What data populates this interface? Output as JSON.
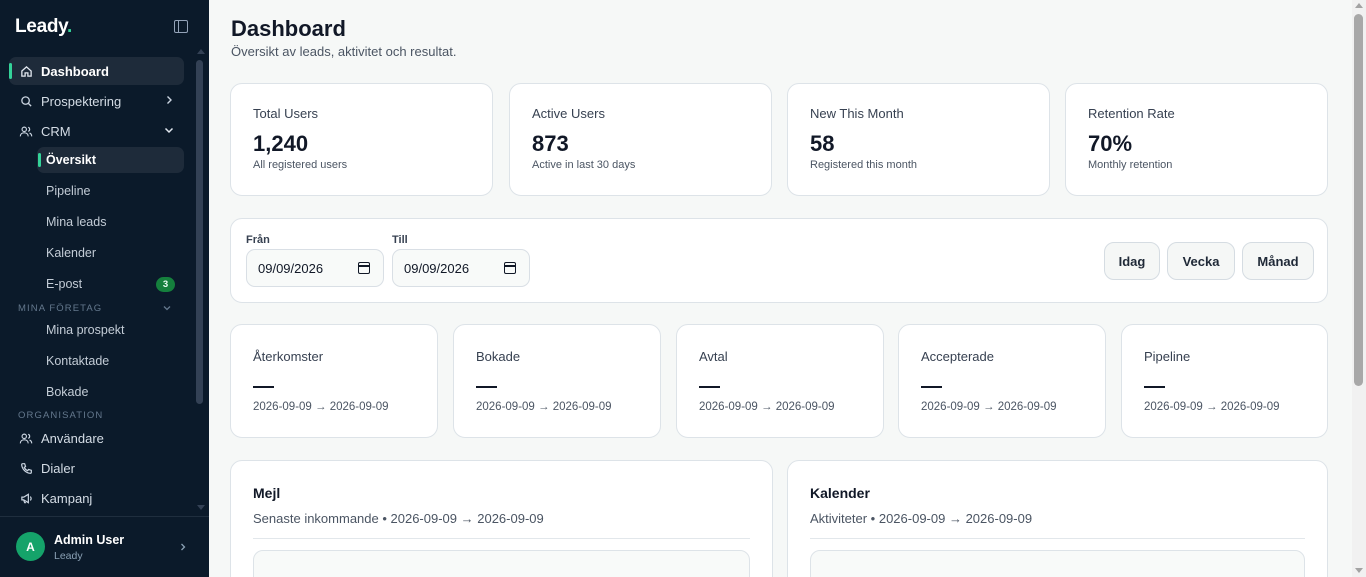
{
  "brand": {
    "name": "Leady",
    "dot": "."
  },
  "nav": {
    "dashboard": "Dashboard",
    "prospektering": "Prospektering",
    "crm": "CRM",
    "crm_items": [
      "Översikt",
      "Pipeline",
      "Mina leads",
      "Kalender",
      "E-post"
    ],
    "email_badge": "3",
    "section_foretag": "Mina företag",
    "foretag_items": [
      "Mina prospekt",
      "Kontaktade",
      "Bokade"
    ],
    "section_org": "Organisation",
    "org_items": [
      "Användare",
      "Dialer",
      "Kampanj"
    ]
  },
  "user": {
    "initial": "A",
    "name": "Admin User",
    "role": "Leady"
  },
  "header": {
    "title": "Dashboard",
    "subtitle": "Översikt av leads, aktivitet och resultat."
  },
  "stats": [
    {
      "label": "Total Users",
      "value": "1,240",
      "sub": "All registered users"
    },
    {
      "label": "Active Users",
      "value": "873",
      "sub": "Active in last 30 days"
    },
    {
      "label": "New This Month",
      "value": "58",
      "sub": "Registered this month"
    },
    {
      "label": "Retention Rate",
      "value": "70%",
      "sub": "Monthly retention"
    }
  ],
  "filters": {
    "from_label": "Från",
    "from_value": "09/09/2026",
    "to_label": "Till",
    "to_value": "09/09/2026",
    "buttons": [
      "Idag",
      "Vecka",
      "Månad"
    ]
  },
  "kpis": [
    {
      "label": "Återkomster",
      "value": "—",
      "range": "2026-09-09 → 2026-09-09"
    },
    {
      "label": "Bokade",
      "value": "—",
      "range": "2026-09-09 → 2026-09-09"
    },
    {
      "label": "Avtal",
      "value": "—",
      "range": "2026-09-09 → 2026-09-09"
    },
    {
      "label": "Accepterade",
      "value": "—",
      "range": "2026-09-09 → 2026-09-09"
    },
    {
      "label": "Pipeline",
      "value": "—",
      "range": "2026-09-09 → 2026-09-09"
    }
  ],
  "panels": [
    {
      "title": "Mejl",
      "subtitle": "Senaste inkommande • 2026-09-09 → 2026-09-09"
    },
    {
      "title": "Kalender",
      "subtitle": "Aktiviteter • 2026-09-09 → 2026-09-09"
    }
  ],
  "colors": {
    "sidebar_bg": "#0b1a2a",
    "accent": "#34d399",
    "badge_bg": "#15803d",
    "avatar_bg": "#15a36a"
  }
}
